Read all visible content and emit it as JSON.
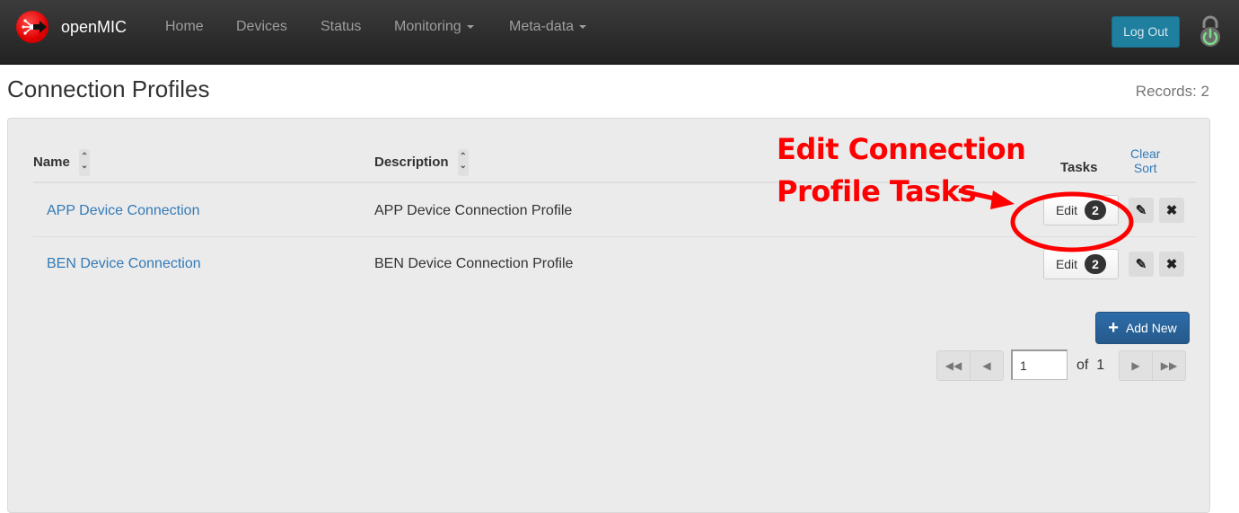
{
  "navbar": {
    "brand": "openMIC",
    "items": [
      {
        "label": "Home",
        "dropdown": false
      },
      {
        "label": "Devices",
        "dropdown": false
      },
      {
        "label": "Status",
        "dropdown": false
      },
      {
        "label": "Monitoring",
        "dropdown": true
      },
      {
        "label": "Meta-data",
        "dropdown": true
      }
    ],
    "logout_label": "Log Out",
    "icons": {
      "logo": "openmic-logo-icon",
      "power": "power-lock-icon"
    }
  },
  "header": {
    "title": "Connection Profiles",
    "records": "Records: 2"
  },
  "table": {
    "columns": {
      "name": "Name",
      "description": "Description",
      "tasks": "Tasks"
    },
    "clear_sort": [
      "Clear",
      "Sort"
    ],
    "rows": [
      {
        "name": "APP Device Connection",
        "description": "APP Device Connection Profile",
        "edit_label": "Edit",
        "task_count": "2"
      },
      {
        "name": "BEN Device Connection",
        "description": "BEN Device Connection Profile",
        "edit_label": "Edit",
        "task_count": "2"
      }
    ]
  },
  "actions": {
    "add_new": "Add New"
  },
  "pagination": {
    "current_page": "1",
    "of_label": "of",
    "total_pages": "1"
  },
  "annotation": {
    "line1": "Edit Connection",
    "line2": "Profile Tasks",
    "color": "#ff0000"
  }
}
